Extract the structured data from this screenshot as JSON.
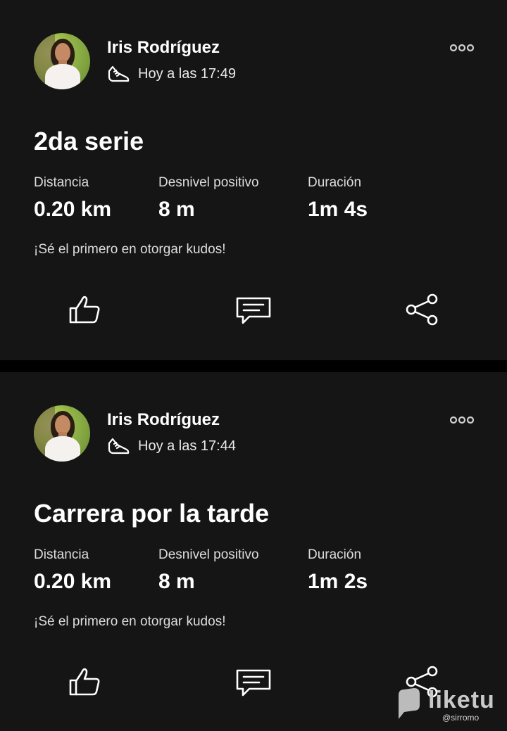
{
  "posts": [
    {
      "user_name": "Iris Rodríguez",
      "timestamp": "Hoy a las 17:49",
      "activity_title": "2da serie",
      "stats": [
        {
          "label": "Distancia",
          "value": "0.20 km"
        },
        {
          "label": "Desnivel positivo",
          "value": "8 m"
        },
        {
          "label": "Duración",
          "value": "1m 4s"
        }
      ],
      "kudos_text": "¡Sé el primero en otorgar kudos!"
    },
    {
      "user_name": "Iris Rodríguez",
      "timestamp": "Hoy a las 17:44",
      "activity_title": "Carrera por la tarde",
      "stats": [
        {
          "label": "Distancia",
          "value": "0.20 km"
        },
        {
          "label": "Desnivel positivo",
          "value": "8 m"
        },
        {
          "label": "Duración",
          "value": "1m 2s"
        }
      ],
      "kudos_text": "¡Sé el primero en otorgar kudos!"
    }
  ],
  "icons": {
    "activity": "running-shoe-icon",
    "more": "more-options-icon",
    "kudos": "thumbs-up-icon",
    "comment": "comment-icon",
    "share": "share-icon"
  },
  "watermark": {
    "brand": "liketu",
    "handle": "@sirromo"
  },
  "colors": {
    "background": "#000000",
    "card": "#151515",
    "text": "#ffffff"
  }
}
